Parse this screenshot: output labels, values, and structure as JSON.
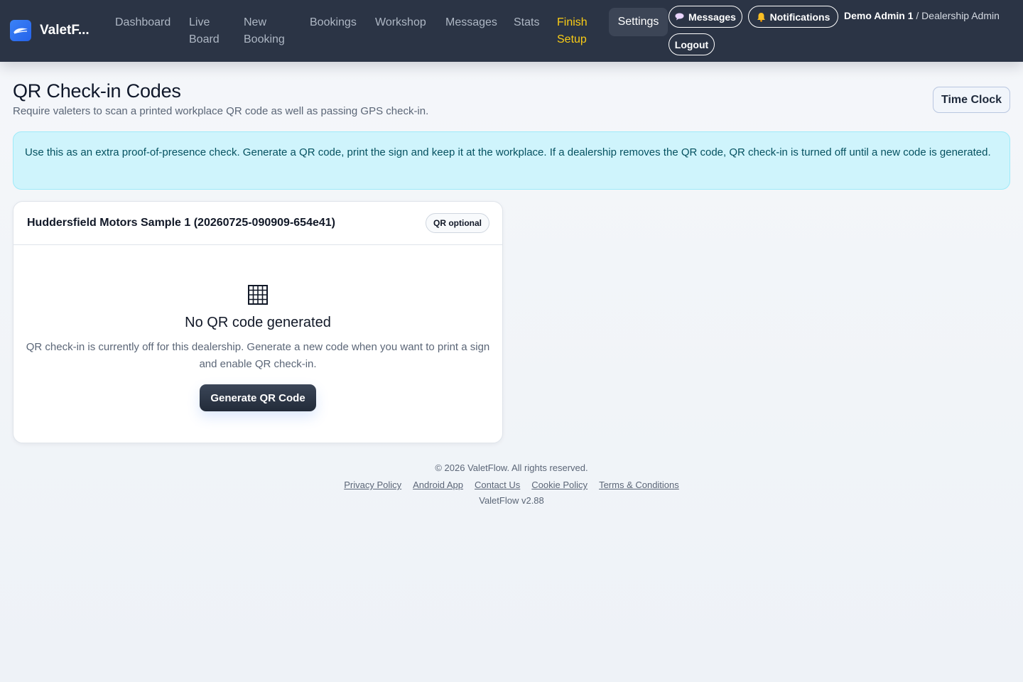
{
  "nav": {
    "brand": "ValetF...",
    "links": [
      {
        "line1": "Dashboard",
        "line2": ""
      },
      {
        "line1": "Live",
        "line2": "Board"
      },
      {
        "line1": "New",
        "line2": "Booking"
      },
      {
        "line1": "Bookings",
        "line2": ""
      },
      {
        "line1": "Workshop",
        "line2": ""
      },
      {
        "line1": "Messages",
        "line2": ""
      },
      {
        "line1": "Stats",
        "line2": ""
      },
      {
        "line1": "Finish",
        "line2": "Setup"
      }
    ],
    "settings": "Settings",
    "messages_button": "Messages",
    "notifications_button": "Notifications",
    "user_name": "Demo Admin 1",
    "user_role": "/ Dealership Admin",
    "logout": "Logout",
    "accent_finish_color": "#facc15"
  },
  "page": {
    "title": "QR Check-in Codes",
    "subtitle": "Require valeters to scan a printed workplace QR code as well as passing GPS check-in.",
    "time_clock": "Time Clock"
  },
  "info": {
    "text": "Use this as an extra proof-of-presence check. Generate a QR code, print the sign and keep it at the workplace. If a dealership removes the QR code, QR check-in is turned off until a new code is generated."
  },
  "card": {
    "title": "Huddersfield Motors Sample 1 (20260725-090909-654e41)",
    "badge": "QR optional",
    "empty_title": "No QR code generated",
    "empty_desc": "QR check-in is currently off for this dealership. Generate a new code when you want to print a sign and enable QR check-in.",
    "button": "Generate QR Code",
    "icon": "grid-icon"
  },
  "footer": {
    "copyright": "© 2026 ValetFlow. All rights reserved.",
    "links": [
      "Privacy Policy",
      "Android App",
      "Contact Us",
      "Cookie Policy",
      "Terms & Conditions"
    ],
    "version": "ValetFlow v2.88"
  }
}
